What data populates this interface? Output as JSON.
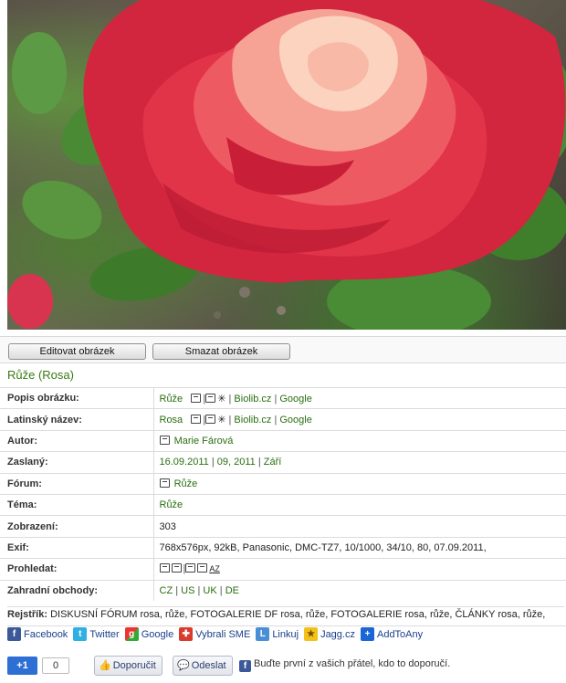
{
  "buttons": {
    "edit": "Editovat obrázek",
    "delete": "Smazat obrázek"
  },
  "title": "Růže (Rosa)",
  "info": {
    "popis": {
      "label": "Popis obrázku:",
      "value": "Růže",
      "link1": "Biolib.cz",
      "link2": "Google"
    },
    "latin": {
      "label": "Latinský název:",
      "value": "Rosa",
      "link1": "Biolib.cz",
      "link2": "Google"
    },
    "autor": {
      "label": "Autor:",
      "value": "Marie Fárová"
    },
    "zaslany": {
      "label": "Zaslaný:",
      "date": "16.09.2011",
      "day": "09, 2011",
      "month": "Září"
    },
    "forum": {
      "label": "Fórum:",
      "value": "Růže"
    },
    "tema": {
      "label": "Téma:",
      "value": "Růže"
    },
    "zobrazeni": {
      "label": "Zobrazení:",
      "value": "303"
    },
    "exif": {
      "label": "Exif:",
      "value": "768x576px, 92kB, Panasonic, DMC-TZ7, 10/1000, 34/10, 80, 07.09.2011,"
    },
    "prohledat": {
      "label": "Prohledat:",
      "az": "AZ"
    },
    "obchody": {
      "label": "Zahradní obchody:",
      "cz": "CZ",
      "us": "US",
      "uk": "UK",
      "de": "DE"
    }
  },
  "rejstrik": {
    "label": "Rejstřík:",
    "text": "DISKUSNÍ FÓRUM rosa, růže, FOTOGALERIE DF rosa, růže, FOTOGALERIE rosa, růže, ČLÁNKY rosa, růže,"
  },
  "share": [
    "Facebook",
    "Twitter",
    "Google",
    "Vybrali SME",
    "Linkuj",
    "Jagg.cz",
    "AddToAny"
  ],
  "social": {
    "gplus": "+1",
    "gcount": "0",
    "recommend": "Doporučit",
    "send": "Odeslat",
    "note": "Buďte první z vašich přátel, kdo to doporučí."
  },
  "colors": {
    "accent": "#2a6e10",
    "link_blue": "#1b3f8b",
    "facebook": "#3b5998",
    "gplus": "#2d6fd2"
  }
}
